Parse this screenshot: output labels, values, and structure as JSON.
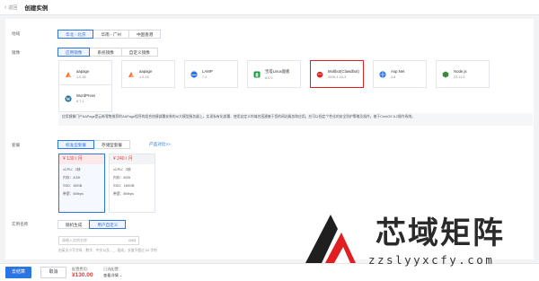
{
  "header": {
    "back_label": "返回",
    "title": "创建实例"
  },
  "region": {
    "label": "地域",
    "options": [
      "华北 - 北京",
      "华南 - 广州",
      "中国香港"
    ],
    "selected": 0
  },
  "image": {
    "label": "镜像",
    "tabs": [
      "应用镜像",
      "系统镜像",
      "自定义镜像"
    ],
    "selected": 0,
    "cards": [
      {
        "name": "aapage",
        "version": "1.0.16",
        "icon": "aapage-icon",
        "color": "#ff6a2b"
      },
      {
        "name": "aapage",
        "version": "1.0.15",
        "icon": "aapage-icon",
        "color": "#ff6a2b"
      },
      {
        "name": "LAMP",
        "version": "7.4",
        "icon": "lamp-icon",
        "color": "#2b74e4"
      },
      {
        "name": "宝塔Linux面板",
        "version": "8.0.0",
        "icon": "baota-icon",
        "color": "#1a9e3f"
      },
      {
        "name": "Moltbot(Clawdbot)",
        "version": "2026.1.24-3",
        "icon": "moltbot-icon",
        "color": "#e02020"
      },
      {
        "name": "Asp.Net",
        "version": "4.8",
        "icon": "aspnet-icon",
        "color": "#2b74e4"
      },
      {
        "name": "Node.js",
        "version": "22.11.0",
        "icon": "nodejs-icon",
        "color": "#3c873a"
      },
      {
        "name": "WordPress",
        "version": "6.7.1",
        "icon": "wordpress-icon",
        "color": "#21759b"
      }
    ],
    "selected_card": 4,
    "description": "应用镜像门户AAPage是云新零售推荐的AAPage程序的组合快捷部署安装的AI大模型服务器上。实现私有化部署、使用自定义的域名搭建基于您的网站服务和应用。应可以指定个性化的安全防护策略及插件。基于CentOS 8.2操作系统。"
  },
  "package": {
    "label": "套餐",
    "tabs": [
      "标准型套餐",
      "存储型套餐"
    ],
    "selected": 0,
    "compare_link": "产品对比>>",
    "tiers": [
      {
        "price": "¥ 130 / 月",
        "cpu": "vCPU：2核",
        "mem": "内存：4GB",
        "ssd": "SSD：80GB",
        "bw": "带宽：6Mbps"
      },
      {
        "price": "¥ 240 / 月",
        "cpu": "vCPU：2核",
        "mem": "内存：8GB",
        "ssd": "SSD：160GB",
        "bw": "带宽：8Mbps"
      }
    ],
    "selected_tier": 0
  },
  "instance_name": {
    "label": "实例名称",
    "tabs": [
      "随机生成",
      "用户自定义"
    ],
    "selected": 1,
    "placeholder": "请输入实例名称",
    "counter": "0/63",
    "hint": "由英文小写字母、数字、中文以及 - _ . 组成，长度不超过 63 字符"
  },
  "footer": {
    "submit_label": "去结算",
    "cancel_label": "取消",
    "fee_label": "配置费用：",
    "fee_value": "¥130.00",
    "picked_label": "已选配置：",
    "detail_label": "查看详情 ⌄"
  },
  "watermark": {
    "title": "芯域矩阵",
    "url": "zzslyyxcfy.com",
    "color": "#e02020"
  },
  "colors": {
    "accent": "#2b74e4",
    "price": "#e03b3b",
    "highlight": "#e02020"
  }
}
